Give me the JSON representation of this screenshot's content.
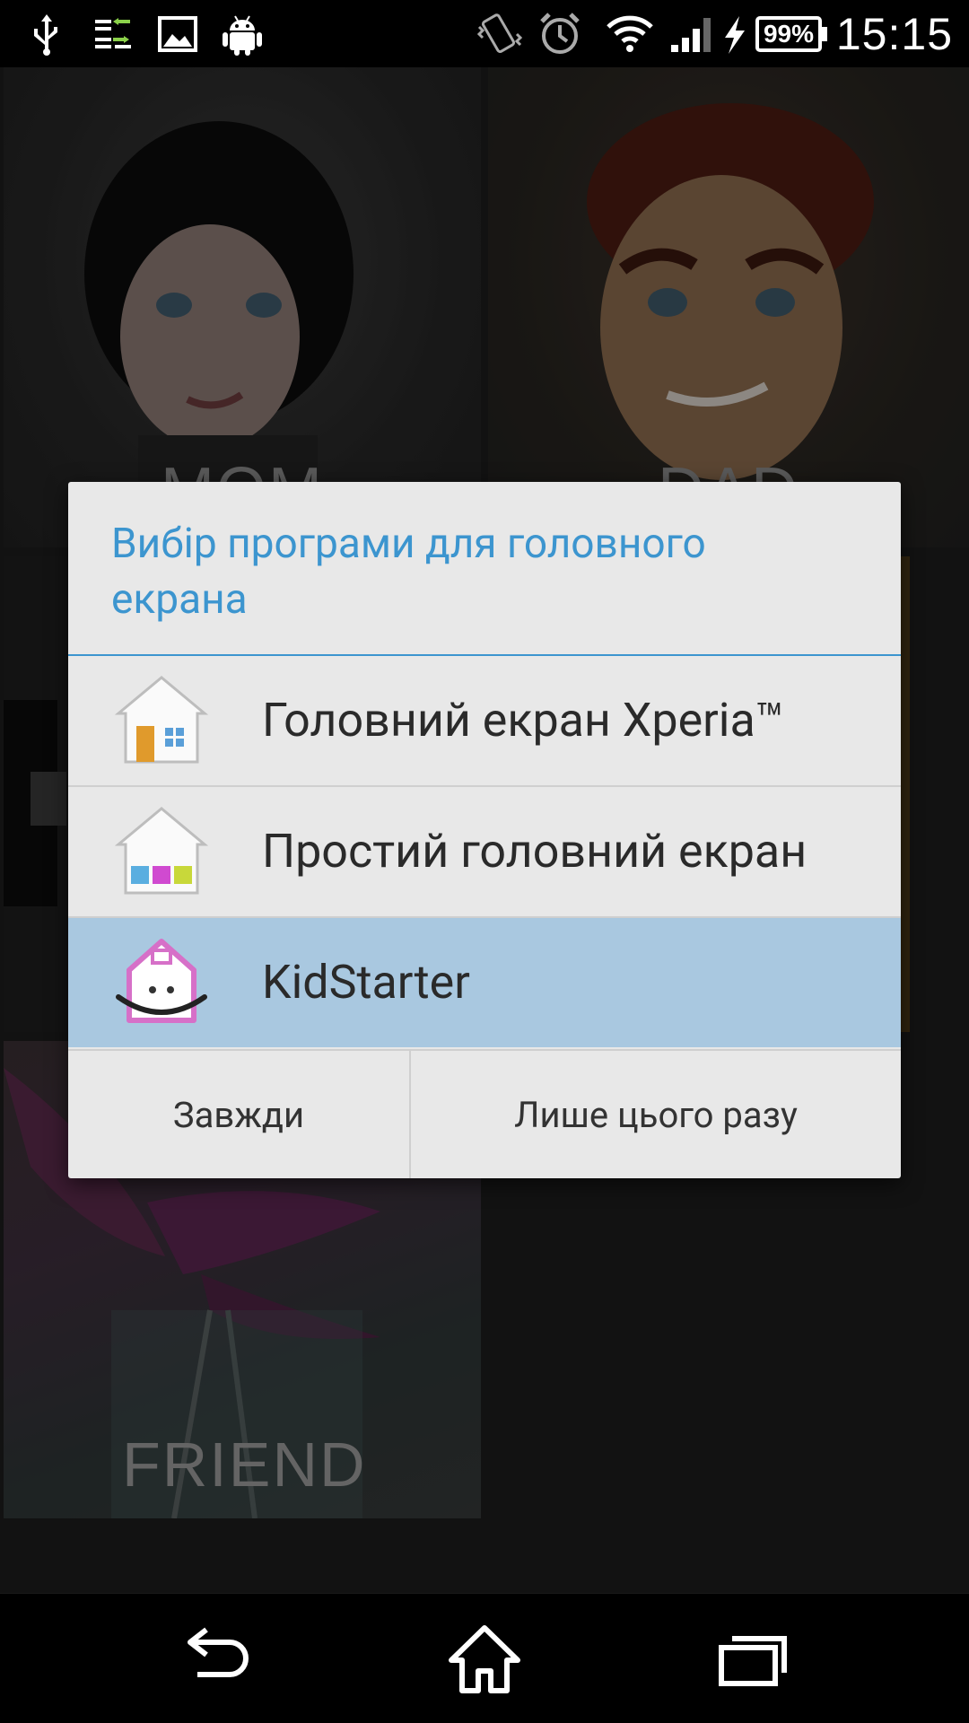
{
  "status_bar": {
    "time": "15:15",
    "battery": "99%",
    "icons": [
      "usb-icon",
      "data-transfer-icon",
      "image-icon",
      "android-debug-icon",
      "vibrate-icon",
      "alarm-icon",
      "wifi-icon",
      "signal-icon",
      "charging-icon"
    ]
  },
  "background": {
    "tiles": [
      {
        "name": "MOM"
      },
      {
        "name": "DAD"
      },
      {
        "name": ""
      },
      {
        "name": ""
      },
      {
        "name": "FRIEND"
      }
    ]
  },
  "dialog": {
    "title": "Вибір програми для головного екрана",
    "items": [
      {
        "label": "Головний екран Xperia™",
        "icon": "xperia-home-icon",
        "selected": false
      },
      {
        "label": "Простий головний екран",
        "icon": "simple-home-icon",
        "selected": false
      },
      {
        "label": "KidStarter",
        "icon": "kidstarter-icon",
        "selected": true
      }
    ],
    "buttons": {
      "always": "Завжди",
      "just_once": "Лише цього разу"
    }
  },
  "nav_bar": {
    "buttons": [
      "back-icon",
      "home-icon",
      "recents-icon"
    ]
  },
  "colors": {
    "accent": "#3c95cf",
    "selected_row": "#a9c8e0",
    "dialog_bg": "#e8e8e8"
  }
}
